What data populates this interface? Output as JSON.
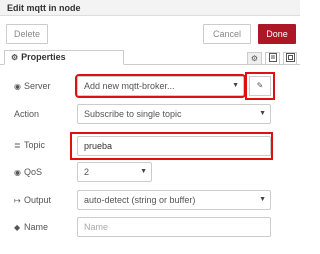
{
  "window": {
    "title": "Edit mqtt in node"
  },
  "toolbar": {
    "delete_label": "Delete",
    "cancel_label": "Cancel",
    "done_label": "Done"
  },
  "tabs": {
    "properties_label": "Properties"
  },
  "form": {
    "server": {
      "label": "Server",
      "value": "Add new mqtt-broker..."
    },
    "action": {
      "label": "Action",
      "value": "Subscribe to single topic"
    },
    "topic": {
      "label": "Topic",
      "value": "prueba"
    },
    "qos": {
      "label": "QoS",
      "value": "2"
    },
    "output": {
      "label": "Output",
      "value": "auto-detect (string or buffer)"
    },
    "name": {
      "label": "Name",
      "placeholder": "Name"
    }
  },
  "colors": {
    "done_button": "#ad1625",
    "highlight": "#dd1111"
  },
  "icons": [
    "gear-icon",
    "globe-icon",
    "list-icon",
    "radio-icon",
    "sign-out-icon",
    "tag-icon",
    "pencil-icon",
    "doc-icon",
    "frame-icon",
    "chevron-down-icon"
  ]
}
